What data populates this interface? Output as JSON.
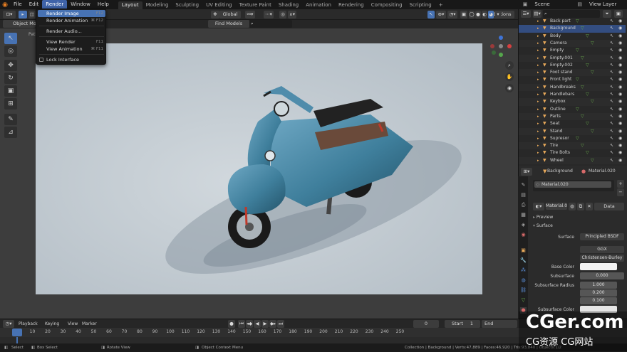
{
  "menubar": {
    "items": [
      "File",
      "Edit",
      "Render",
      "Window",
      "Help"
    ],
    "active": "Render",
    "workspaces": [
      "Layout",
      "Modeling",
      "Sculpting",
      "UV Editing",
      "Texture Paint",
      "Shading",
      "Animation",
      "Rendering",
      "Compositing",
      "Scripting"
    ],
    "active_workspace": "Layout",
    "add_tab": "+",
    "scene": "Scene",
    "view_layer": "View Layer"
  },
  "render_menu": {
    "items": [
      {
        "label": "Render Image",
        "shortcut": "F12"
      },
      {
        "label": "Render Animation",
        "shortcut": "⌘ F12"
      },
      {
        "label": "Render Audio..."
      },
      {
        "label": "View Render",
        "shortcut": "F11"
      },
      {
        "label": "View Animation",
        "shortcut": "⌘ F11"
      },
      {
        "label": "Lock Interface"
      }
    ]
  },
  "header3d": {
    "object_mode": "Object Mode",
    "pivot": "Global",
    "options": "Options",
    "find": "Find Models",
    "path_label": "Path"
  },
  "outliner": {
    "items": [
      {
        "name": "Back part",
        "selected": false
      },
      {
        "name": "Background",
        "selected": true
      },
      {
        "name": "Body",
        "selected": false
      },
      {
        "name": "Camera",
        "selected": false
      },
      {
        "name": "Empty",
        "selected": false
      },
      {
        "name": "Empty.001",
        "selected": false
      },
      {
        "name": "Empty.002",
        "selected": false
      },
      {
        "name": "Foot stand",
        "selected": false
      },
      {
        "name": "Front light",
        "selected": false
      },
      {
        "name": "Handbreaks",
        "selected": false
      },
      {
        "name": "Handlebars",
        "selected": false
      },
      {
        "name": "Keybox",
        "selected": false
      },
      {
        "name": "Outline",
        "selected": false
      },
      {
        "name": "Parts",
        "selected": false
      },
      {
        "name": "Seat",
        "selected": false
      },
      {
        "name": "Stand",
        "selected": false
      },
      {
        "name": "Supresor",
        "selected": false
      },
      {
        "name": "Tire",
        "selected": false
      },
      {
        "name": "Tire Bolts",
        "selected": false
      },
      {
        "name": "Wheel",
        "selected": false
      }
    ]
  },
  "properties": {
    "object": "Background",
    "material": "Material.020",
    "slot": "Material.020",
    "material_field": "Material.0",
    "data_btn": "Data",
    "preview": "Preview",
    "surface_section": "Surface",
    "surface_label": "Surface",
    "surface_value": "Principled BSDF",
    "distribution": "GGX",
    "subsurface_method": "Christensen-Burley",
    "base_color_label": "Base Color",
    "subsurface_label": "Subsurface",
    "subsurface_value": "0.000",
    "subsurface_radius_label": "Subsurface Radius",
    "radius": [
      "1.000",
      "0.200",
      "0.100"
    ],
    "subsurface_color_label": "Subsurface Color"
  },
  "timeline": {
    "playback": "Playback",
    "keying": "Keying",
    "view": "View",
    "marker": "Marker",
    "current_frame": "0",
    "start_label": "Start",
    "start": "1",
    "end_label": "End",
    "ticks": [
      "0",
      "10",
      "20",
      "30",
      "40",
      "50",
      "60",
      "70",
      "80",
      "90",
      "100",
      "110",
      "120",
      "130",
      "140",
      "150",
      "160",
      "170",
      "180",
      "190",
      "200",
      "210",
      "220",
      "230",
      "240",
      "250"
    ]
  },
  "status": {
    "select": "Select",
    "box_select": "Box Select",
    "rotate_view": "Rotate View",
    "context_menu": "Object Context Menu",
    "stats": "Collection | Background | Verts:47,889 | Faces:46,920 | Tris:93,840 | Objects:1/2"
  },
  "watermark": {
    "main": "CGer.com",
    "sub": "CG资源 CG网站"
  },
  "colors": {
    "accent": "#4772b3",
    "render_bg": "#c3ccd2",
    "scooter": "#3f7f9c"
  }
}
